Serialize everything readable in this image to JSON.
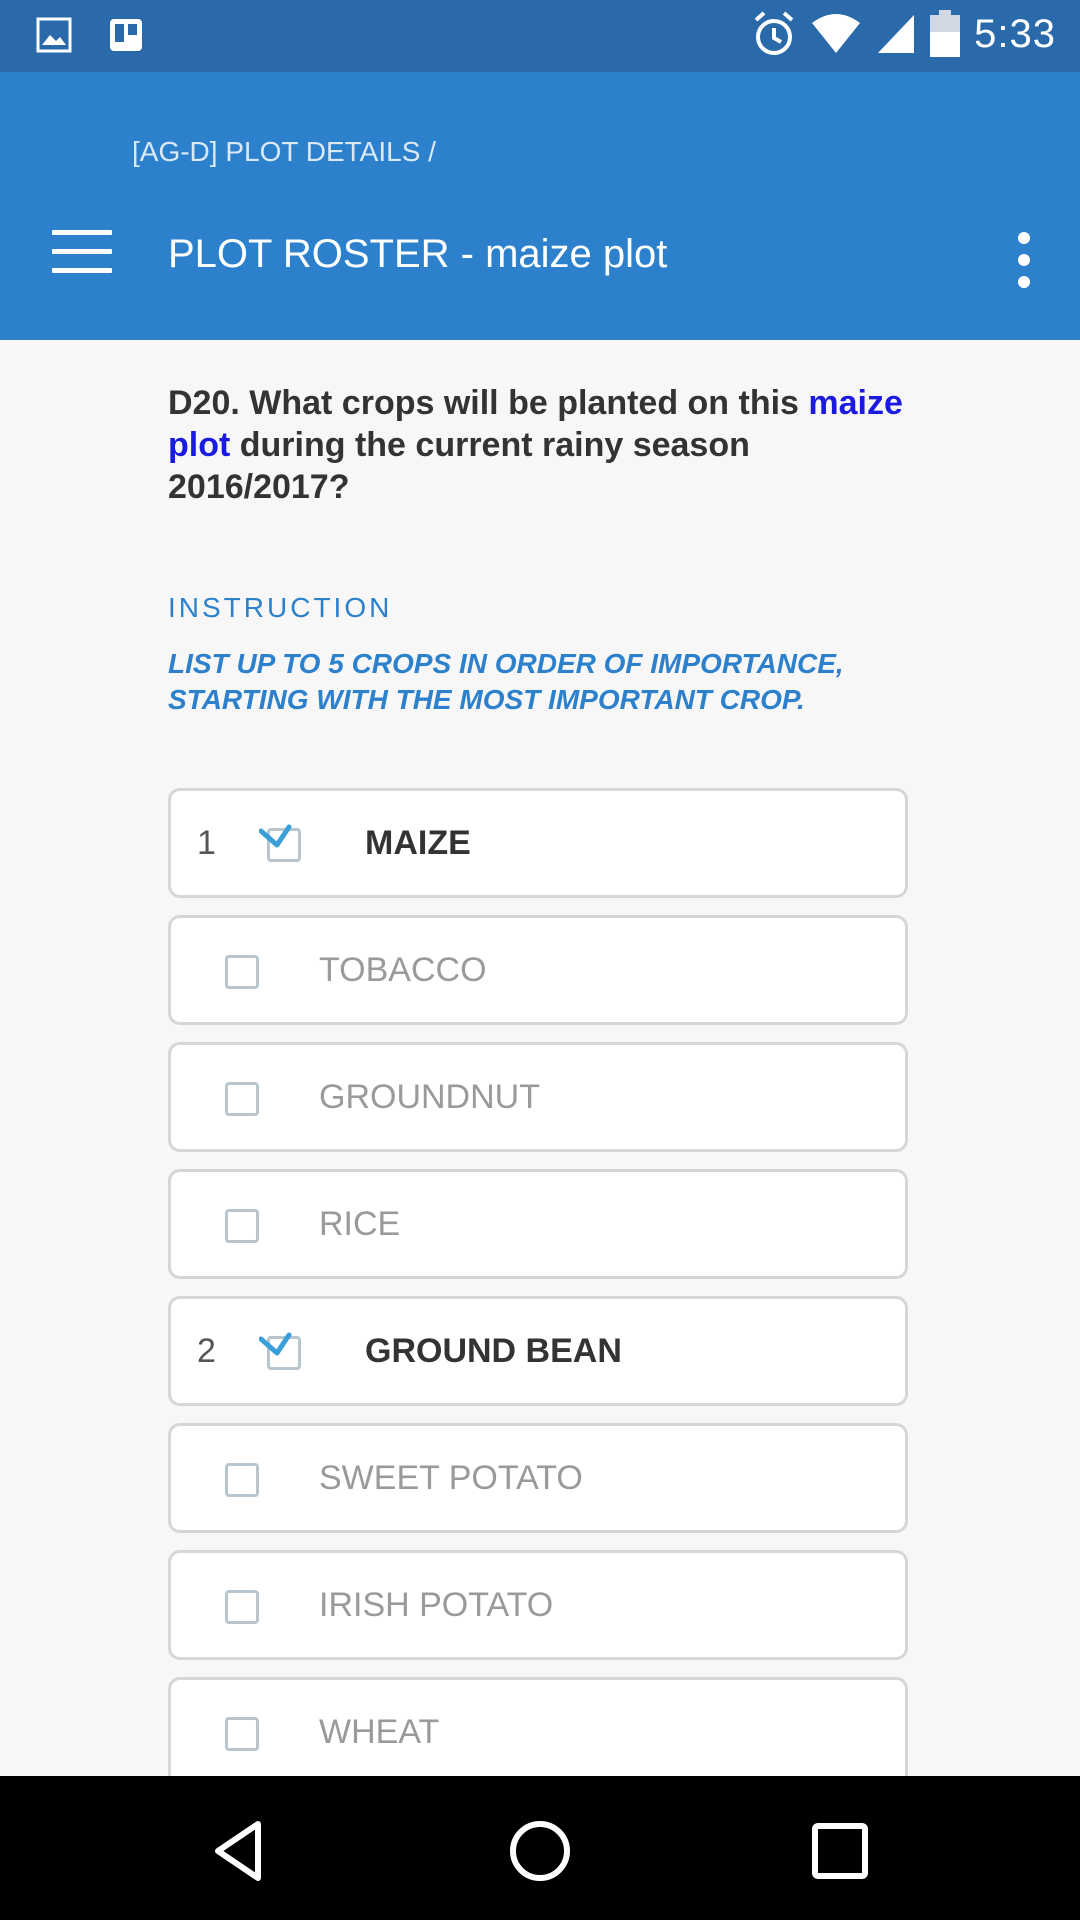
{
  "status_bar": {
    "time": "5:33",
    "icons": [
      "image-icon",
      "trello-icon",
      "alarm-icon",
      "wifi-icon",
      "signal-icon",
      "battery-icon"
    ]
  },
  "app_bar": {
    "breadcrumb": "[AG-D] PLOT DETAILS /",
    "title": "PLOT ROSTER - maize plot",
    "menu_icon": "hamburger-menu-icon",
    "overflow_icon": "overflow-menu-icon"
  },
  "question": {
    "prefix": "D20. What crops will be planted on this ",
    "highlight": "maize plot",
    "suffix": " during the current rainy season 2016/2017?"
  },
  "instruction": {
    "label": "INSTRUCTION",
    "text": "LIST UP TO 5 CROPS IN ORDER OF IMPORTANCE, STARTING WITH THE MOST IMPORTANT CROP."
  },
  "options": [
    {
      "label": "MAIZE",
      "checked": true,
      "order": "1"
    },
    {
      "label": "TOBACCO",
      "checked": false,
      "order": ""
    },
    {
      "label": "GROUNDNUT",
      "checked": false,
      "order": ""
    },
    {
      "label": "RICE",
      "checked": false,
      "order": ""
    },
    {
      "label": "GROUND BEAN",
      "checked": true,
      "order": "2"
    },
    {
      "label": "SWEET POTATO",
      "checked": false,
      "order": ""
    },
    {
      "label": "IRISH POTATO",
      "checked": false,
      "order": ""
    },
    {
      "label": "WHEAT",
      "checked": false,
      "order": ""
    }
  ],
  "nav_bar": {
    "icons": [
      "back-icon",
      "home-icon",
      "recents-icon"
    ]
  },
  "colors": {
    "status_bar": "#2a6aaa",
    "app_bar": "#2d81cc",
    "highlight": "#1a1ae0",
    "check": "#3a9fd8"
  }
}
